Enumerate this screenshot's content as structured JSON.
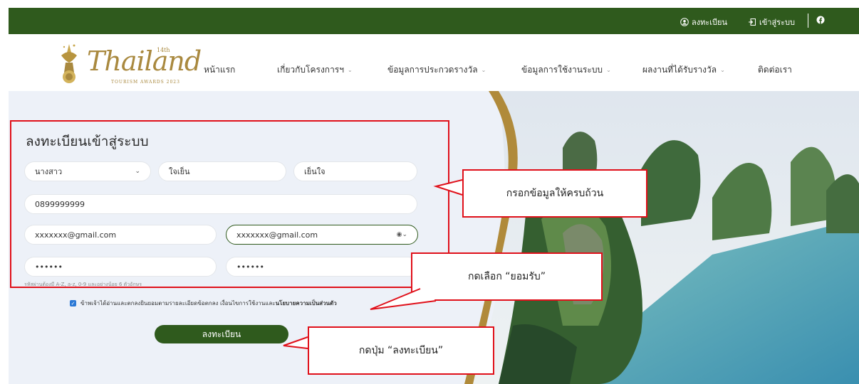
{
  "topbar": {
    "register_label": "ลงทะเบียน",
    "login_label": "เข้าสู่ระบบ",
    "facebook_icon": "facebook-icon"
  },
  "logo": {
    "main": "Thailand",
    "sup": "14th",
    "sub": "TOURISM AWARDS 2023"
  },
  "nav": {
    "items": [
      {
        "label": "หน้าแรก"
      },
      {
        "label": "เกี่ยวกับโครงการฯ"
      },
      {
        "label": "ข้อมูลการประกวดรางวัล"
      },
      {
        "label": "ข้อมูลการใช้งานระบบ"
      },
      {
        "label": "ผลงานที่ได้รับรางวัล"
      },
      {
        "label": "ติดต่อเรา"
      }
    ]
  },
  "form": {
    "title": "ลงทะเบียนเข้าสู่ระบบ",
    "prefix": "นางสาว",
    "first_name": "ใจเย็น",
    "last_name": "เย็นใจ",
    "phone": "0899999999",
    "email": "xxxxxxx@gmail.com",
    "email_confirm": "xxxxxxx@gmail.com",
    "password": "••••••",
    "password_confirm": "••••••",
    "password_hint": "รหัสผ่านต้องมี A-Z, a-z, 0-9 และอย่างน้อย 6 ตัวอักษร",
    "consent_text": "ข้าพเจ้าได้อ่านและตกลงยินยอมตามรายละเอียดข้อตกลง เงื่อนไขการใช้งานและ",
    "consent_link": "นโยบายความเป็นส่วนตัว",
    "submit_label": "ลงทะเบียน"
  },
  "annotations": {
    "fill_info": "กรอกข้อมูลให้ครบถ้วน",
    "accept": "กดเลือก “ยอมรับ”",
    "press_register": "กดปุ่ม “ลงทะเบียน”",
    "color": "#e0101a"
  },
  "colors": {
    "brand_green": "#2f5a1d",
    "gold": "#a9893f",
    "checkbox_blue": "#2b79d6"
  }
}
